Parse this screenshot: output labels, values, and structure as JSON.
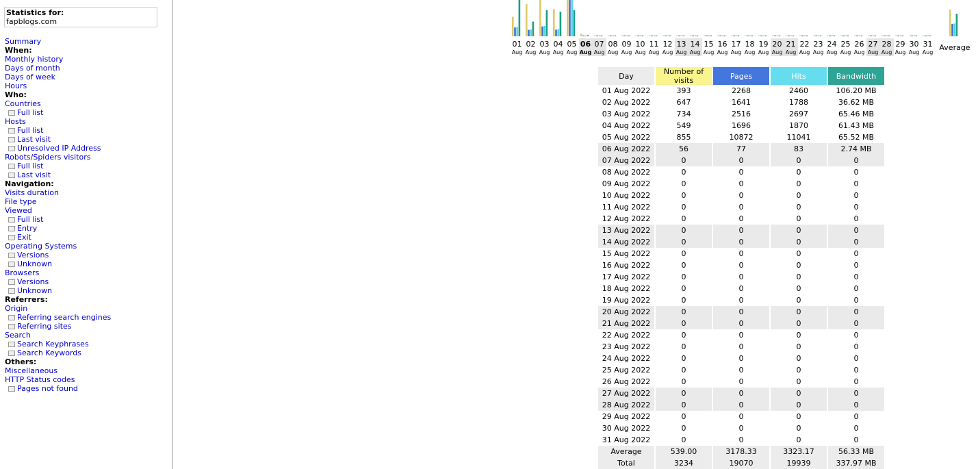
{
  "stats": {
    "label": "Statistics for:",
    "site": "fapblogs.com"
  },
  "menu": [
    {
      "type": "link",
      "label": "Summary",
      "name": "menu-summary"
    },
    {
      "type": "head",
      "label": "When:",
      "name": "menu-heading-when"
    },
    {
      "type": "link",
      "label": "Monthly history",
      "name": "menu-monthly-history"
    },
    {
      "type": "link",
      "label": "Days of month",
      "name": "menu-days-of-month"
    },
    {
      "type": "link",
      "label": "Days of week",
      "name": "menu-days-of-week"
    },
    {
      "type": "link",
      "label": "Hours",
      "name": "menu-hours"
    },
    {
      "type": "head",
      "label": "Who:",
      "name": "menu-heading-who"
    },
    {
      "type": "link",
      "label": "Countries",
      "name": "menu-countries"
    },
    {
      "type": "sub",
      "label": "Full list",
      "name": "menu-countries-full-list"
    },
    {
      "type": "link",
      "label": "Hosts",
      "name": "menu-hosts"
    },
    {
      "type": "sub",
      "label": "Full list",
      "name": "menu-hosts-full-list"
    },
    {
      "type": "sub",
      "label": "Last visit",
      "name": "menu-hosts-last-visit"
    },
    {
      "type": "sub",
      "label": "Unresolved IP Address",
      "name": "menu-hosts-unresolved-ip"
    },
    {
      "type": "link",
      "label": "Robots/Spiders visitors",
      "name": "menu-robots"
    },
    {
      "type": "sub",
      "label": "Full list",
      "name": "menu-robots-full-list"
    },
    {
      "type": "sub",
      "label": "Last visit",
      "name": "menu-robots-last-visit"
    },
    {
      "type": "head",
      "label": "Navigation:",
      "name": "menu-heading-navigation"
    },
    {
      "type": "link",
      "label": "Visits duration",
      "name": "menu-visits-duration"
    },
    {
      "type": "link",
      "label": "File type",
      "name": "menu-file-type"
    },
    {
      "type": "link",
      "label": "Viewed",
      "name": "menu-viewed"
    },
    {
      "type": "sub",
      "label": "Full list",
      "name": "menu-viewed-full-list"
    },
    {
      "type": "sub",
      "label": "Entry",
      "name": "menu-viewed-entry"
    },
    {
      "type": "sub",
      "label": "Exit",
      "name": "menu-viewed-exit"
    },
    {
      "type": "link",
      "label": "Operating Systems",
      "name": "menu-operating-systems"
    },
    {
      "type": "sub",
      "label": "Versions",
      "name": "menu-os-versions"
    },
    {
      "type": "sub",
      "label": "Unknown",
      "name": "menu-os-unknown"
    },
    {
      "type": "link",
      "label": "Browsers",
      "name": "menu-browsers"
    },
    {
      "type": "sub",
      "label": "Versions",
      "name": "menu-browsers-versions"
    },
    {
      "type": "sub",
      "label": "Unknown",
      "name": "menu-browsers-unknown"
    },
    {
      "type": "head",
      "label": "Referrers:",
      "name": "menu-heading-referrers"
    },
    {
      "type": "link",
      "label": "Origin",
      "name": "menu-origin"
    },
    {
      "type": "sub",
      "label": "Referring search engines",
      "name": "menu-referring-search-engines"
    },
    {
      "type": "sub",
      "label": "Referring sites",
      "name": "menu-referring-sites"
    },
    {
      "type": "link",
      "label": "Search",
      "name": "menu-search"
    },
    {
      "type": "sub",
      "label": "Search Keyphrases",
      "name": "menu-search-keyphrases"
    },
    {
      "type": "sub",
      "label": "Search Keywords",
      "name": "menu-search-keywords"
    },
    {
      "type": "head",
      "label": "Others:",
      "name": "menu-heading-others"
    },
    {
      "type": "link",
      "label": "Miscellaneous",
      "name": "menu-miscellaneous"
    },
    {
      "type": "link",
      "label": "HTTP Status codes",
      "name": "menu-http-status-codes"
    },
    {
      "type": "sub",
      "label": "Pages not found",
      "name": "menu-pages-not-found"
    }
  ],
  "colors": {
    "visits": "#f9f48d",
    "pages": "#4477dd",
    "hits": "#66ddee",
    "bandwidth": "#2ea495",
    "visits_bar": "#e0c96a",
    "pages_bar": "#3f6fd8",
    "hits_bar": "#58d4ea",
    "bandwidth_bar": "#1a9e80"
  },
  "chart_data": {
    "type": "bar",
    "month_label": "Aug",
    "average_label": "Average",
    "days": [
      "01",
      "02",
      "03",
      "04",
      "05",
      "06",
      "07",
      "08",
      "09",
      "10",
      "11",
      "12",
      "13",
      "14",
      "15",
      "16",
      "17",
      "18",
      "19",
      "20",
      "21",
      "22",
      "23",
      "24",
      "25",
      "26",
      "27",
      "28",
      "29",
      "30",
      "31"
    ],
    "weekend_days": [
      "06",
      "07",
      "13",
      "14",
      "20",
      "21",
      "27",
      "28"
    ],
    "current_day": "06",
    "series": [
      {
        "name": "Number of visits",
        "values": [
          393,
          647,
          734,
          549,
          855,
          56,
          0,
          0,
          0,
          0,
          0,
          0,
          0,
          0,
          0,
          0,
          0,
          0,
          0,
          0,
          0,
          0,
          0,
          0,
          0,
          0,
          0,
          0,
          0,
          0,
          0
        ],
        "average": 539.0
      },
      {
        "name": "Pages",
        "values": [
          2268,
          1641,
          2516,
          1696,
          10872,
          77,
          0,
          0,
          0,
          0,
          0,
          0,
          0,
          0,
          0,
          0,
          0,
          0,
          0,
          0,
          0,
          0,
          0,
          0,
          0,
          0,
          0,
          0,
          0,
          0,
          0
        ],
        "average": 3178.33
      },
      {
        "name": "Hits",
        "values": [
          2460,
          1788,
          2697,
          1870,
          11041,
          83,
          0,
          0,
          0,
          0,
          0,
          0,
          0,
          0,
          0,
          0,
          0,
          0,
          0,
          0,
          0,
          0,
          0,
          0,
          0,
          0,
          0,
          0,
          0,
          0,
          0
        ],
        "average": 3323.17
      },
      {
        "name": "Bandwidth",
        "values": [
          106.2,
          36.62,
          65.46,
          61.43,
          65.52,
          2.74,
          0,
          0,
          0,
          0,
          0,
          0,
          0,
          0,
          0,
          0,
          0,
          0,
          0,
          0,
          0,
          0,
          0,
          0,
          0,
          0,
          0,
          0,
          0,
          0,
          0
        ],
        "average": 56.33
      }
    ]
  },
  "table": {
    "headers": [
      "Day",
      "Number of visits",
      "Pages",
      "Hits",
      "Bandwidth"
    ],
    "rows": [
      [
        "01 Aug 2022",
        "393",
        "2268",
        "2460",
        "106.20 MB"
      ],
      [
        "02 Aug 2022",
        "647",
        "1641",
        "1788",
        "36.62 MB"
      ],
      [
        "03 Aug 2022",
        "734",
        "2516",
        "2697",
        "65.46 MB"
      ],
      [
        "04 Aug 2022",
        "549",
        "1696",
        "1870",
        "61.43 MB"
      ],
      [
        "05 Aug 2022",
        "855",
        "10872",
        "11041",
        "65.52 MB"
      ],
      [
        "06 Aug 2022",
        "56",
        "77",
        "83",
        "2.74 MB"
      ],
      [
        "07 Aug 2022",
        "0",
        "0",
        "0",
        "0"
      ],
      [
        "08 Aug 2022",
        "0",
        "0",
        "0",
        "0"
      ],
      [
        "09 Aug 2022",
        "0",
        "0",
        "0",
        "0"
      ],
      [
        "10 Aug 2022",
        "0",
        "0",
        "0",
        "0"
      ],
      [
        "11 Aug 2022",
        "0",
        "0",
        "0",
        "0"
      ],
      [
        "12 Aug 2022",
        "0",
        "0",
        "0",
        "0"
      ],
      [
        "13 Aug 2022",
        "0",
        "0",
        "0",
        "0"
      ],
      [
        "14 Aug 2022",
        "0",
        "0",
        "0",
        "0"
      ],
      [
        "15 Aug 2022",
        "0",
        "0",
        "0",
        "0"
      ],
      [
        "16 Aug 2022",
        "0",
        "0",
        "0",
        "0"
      ],
      [
        "17 Aug 2022",
        "0",
        "0",
        "0",
        "0"
      ],
      [
        "18 Aug 2022",
        "0",
        "0",
        "0",
        "0"
      ],
      [
        "19 Aug 2022",
        "0",
        "0",
        "0",
        "0"
      ],
      [
        "20 Aug 2022",
        "0",
        "0",
        "0",
        "0"
      ],
      [
        "21 Aug 2022",
        "0",
        "0",
        "0",
        "0"
      ],
      [
        "22 Aug 2022",
        "0",
        "0",
        "0",
        "0"
      ],
      [
        "23 Aug 2022",
        "0",
        "0",
        "0",
        "0"
      ],
      [
        "24 Aug 2022",
        "0",
        "0",
        "0",
        "0"
      ],
      [
        "25 Aug 2022",
        "0",
        "0",
        "0",
        "0"
      ],
      [
        "26 Aug 2022",
        "0",
        "0",
        "0",
        "0"
      ],
      [
        "27 Aug 2022",
        "0",
        "0",
        "0",
        "0"
      ],
      [
        "28 Aug 2022",
        "0",
        "0",
        "0",
        "0"
      ],
      [
        "29 Aug 2022",
        "0",
        "0",
        "0",
        "0"
      ],
      [
        "30 Aug 2022",
        "0",
        "0",
        "0",
        "0"
      ],
      [
        "31 Aug 2022",
        "0",
        "0",
        "0",
        "0"
      ]
    ],
    "average": [
      "Average",
      "539.00",
      "3178.33",
      "3323.17",
      "56.33 MB"
    ],
    "total": [
      "Total",
      "3234",
      "19070",
      "19939",
      "337.97 MB"
    ]
  }
}
